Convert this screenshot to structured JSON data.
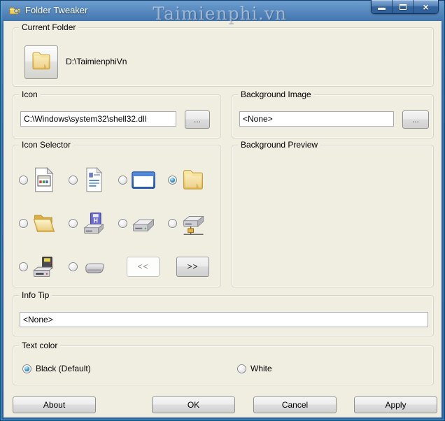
{
  "window": {
    "title": "Folder Tweaker",
    "watermark": "Taimienphi.vn",
    "controls": {
      "minimize": "minimize",
      "maximize": "maximize",
      "close": "close"
    }
  },
  "colors": {
    "titlebar_blue": "#2f639f",
    "frame_highlight_cyan": "#53c3ec",
    "client_bg": "#f0eee1",
    "radio_selected_dot": "#3f9ccb"
  },
  "current_folder": {
    "label": "Current Folder",
    "path": "D:\\TaimienphiVn",
    "button_icon": "folder-icon"
  },
  "icon_group": {
    "label": "Icon",
    "path": "C:\\Windows\\system32\\shell32.dll",
    "browse_label": "..."
  },
  "background_image": {
    "label": "Background Image",
    "value": "<None>",
    "browse_label": "..."
  },
  "icon_selector": {
    "label": "Icon Selector",
    "items": [
      {
        "icon": "application-file-icon",
        "selected": false
      },
      {
        "icon": "document-icon",
        "selected": false
      },
      {
        "icon": "window-icon",
        "selected": false
      },
      {
        "icon": "folder-closed-icon",
        "selected": true
      },
      {
        "icon": "folder-open-icon",
        "selected": false
      },
      {
        "icon": "hdd-floppy-icon",
        "selected": false
      },
      {
        "icon": "hdd-icon",
        "selected": false
      },
      {
        "icon": "network-drive-icon",
        "selected": false
      },
      {
        "icon": "floppy-drive-icon",
        "selected": false
      },
      {
        "icon": "removable-drive-icon",
        "selected": false
      }
    ],
    "prev_label": "<<",
    "next_label": ">>",
    "prev_enabled": false,
    "next_enabled": true
  },
  "background_preview": {
    "label": "Background Preview"
  },
  "info_tip": {
    "label": "Info Tip",
    "value": "<None>"
  },
  "text_color": {
    "label": "Text color",
    "options": [
      {
        "label": "Black (Default)",
        "selected": true
      },
      {
        "label": "White",
        "selected": false
      }
    ]
  },
  "footer": {
    "about": "About",
    "ok": "OK",
    "cancel": "Cancel",
    "apply": "Apply"
  }
}
